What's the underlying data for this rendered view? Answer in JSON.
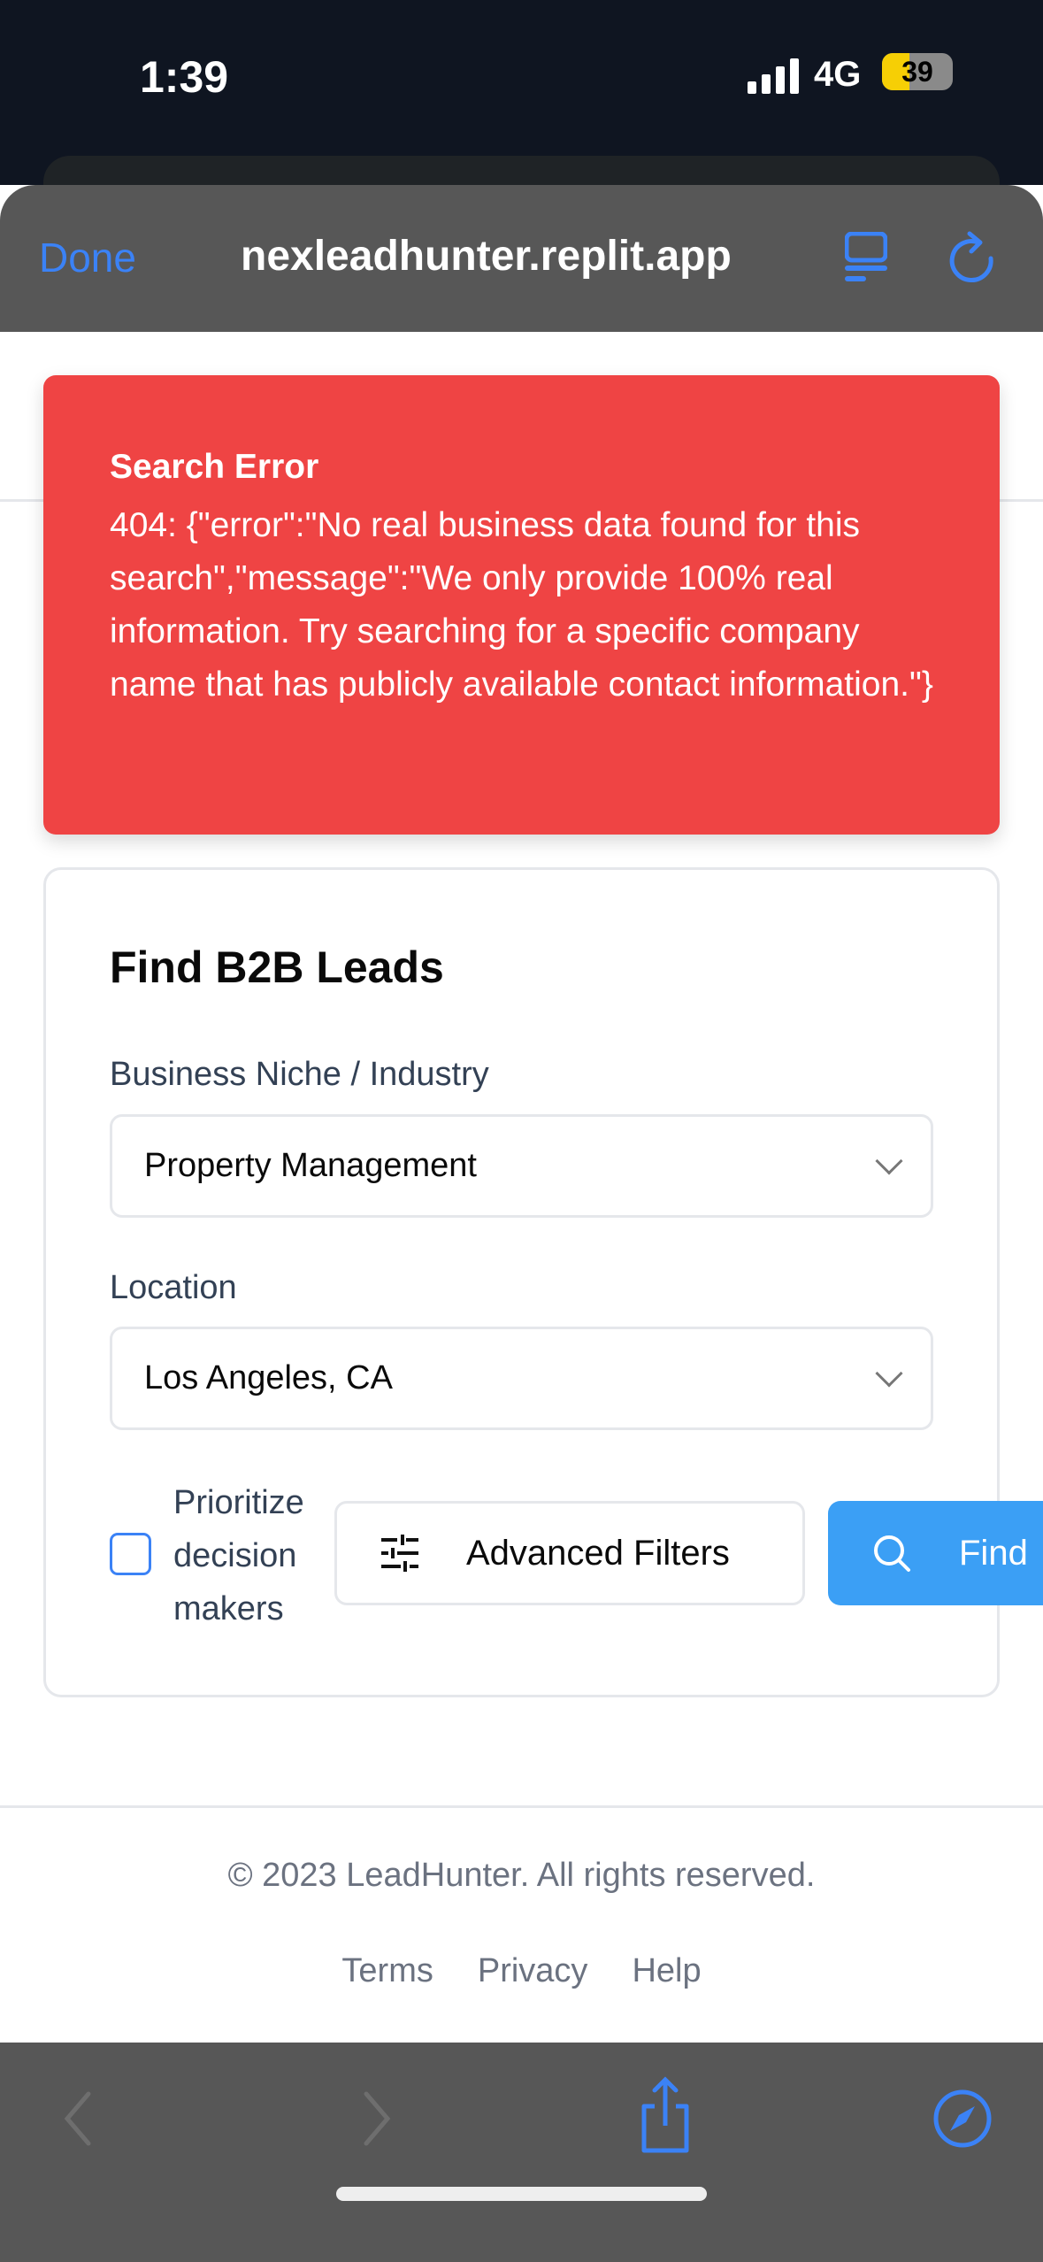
{
  "status": {
    "time": "1:39",
    "network": "4G",
    "battery": "39",
    "battery_level": 0.39
  },
  "browser": {
    "done_label": "Done",
    "url": "nexleadhunter.replit.app"
  },
  "error": {
    "title": "Search Error",
    "message": "404: {\"error\":\"No real business data found for this search\",\"message\":\"We only provide 100% real information. Try searching for a specific company name that has publicly available contact information.\"}"
  },
  "form": {
    "title": "Find B2B Leads",
    "niche_label": "Business Niche / Industry",
    "niche_value": "Property Management",
    "location_label": "Location",
    "location_value": "Los Angeles, CA",
    "prioritize_label": "Prioritize decision makers",
    "prioritize_checked": false,
    "advanced_label": "Advanced Filters",
    "find_label": "Find"
  },
  "footer": {
    "copyright": "© 2023 LeadHunter. All rights reserved.",
    "links": [
      "Terms",
      "Privacy",
      "Help"
    ]
  },
  "colors": {
    "error": "#ef4444",
    "primary": "#3b9ff5",
    "ios_blue": "#3b82f6"
  }
}
